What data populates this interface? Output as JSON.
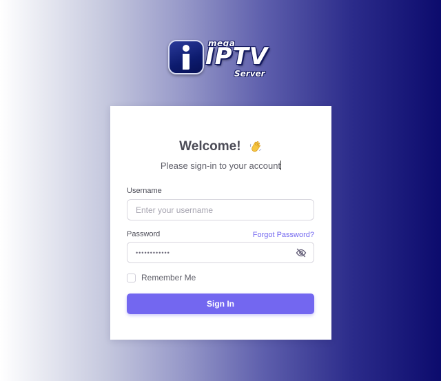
{
  "logo": {
    "top_text": "mega",
    "main_text": "IPTV",
    "bottom_text": "Server",
    "icon": "iptv-logo-icon"
  },
  "login": {
    "title": "Welcome!",
    "title_icon": "waving-hand-icon",
    "subtitle": "Please sign-in to your account",
    "username_label": "Username",
    "username_placeholder": "Enter your username",
    "username_value": "",
    "password_label": "Password",
    "forgot_password": "Forgot Password?",
    "password_value": "••••••••••••",
    "password_toggle_icon": "eye-off-icon",
    "remember_label": "Remember Me",
    "remember_checked": false,
    "signin_label": "Sign In"
  },
  "colors": {
    "accent": "#7367f0",
    "background_dark": "#0c0b6d",
    "card": "#ffffff"
  }
}
